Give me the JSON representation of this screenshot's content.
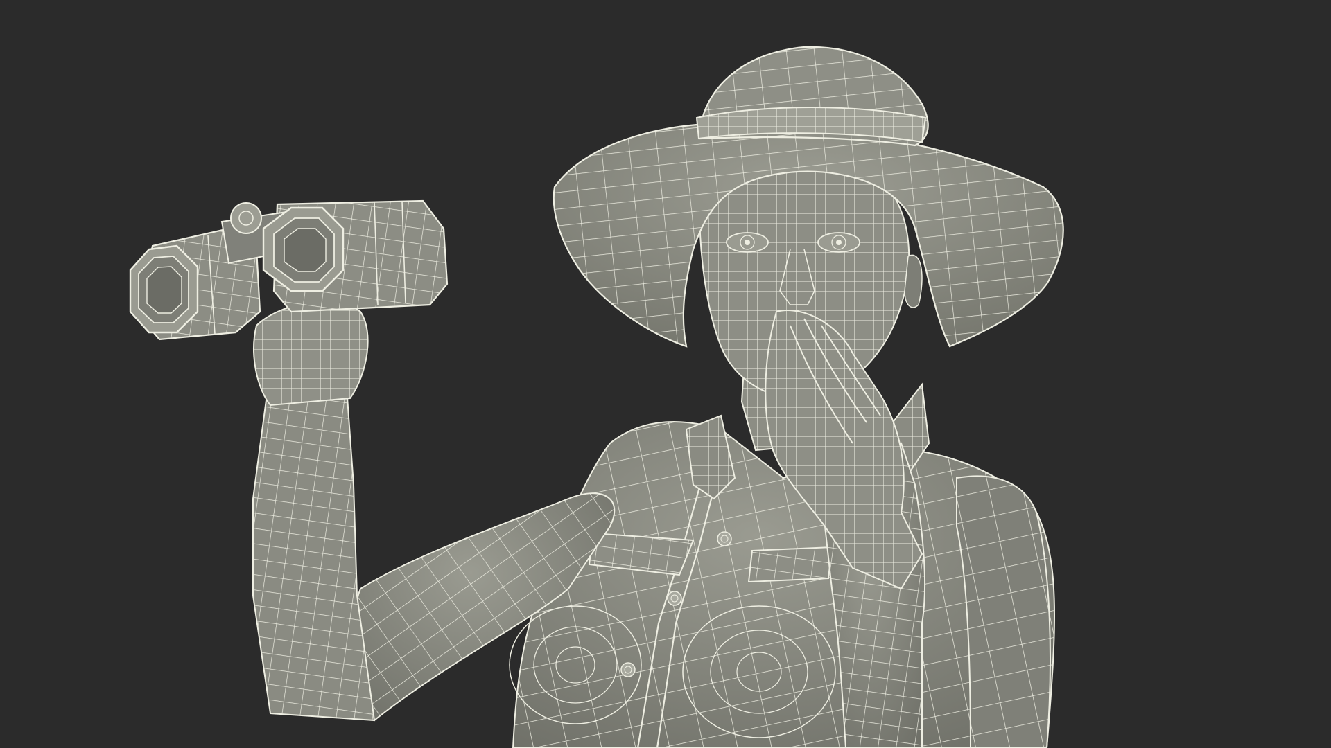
{
  "scene": {
    "subject": "wireframe-render-safari-woman-with-binoculars",
    "colors": {
      "background": "#2b2b2b",
      "mesh_fill": "#84857c",
      "mesh_fill_light": "#9a9b91",
      "mesh_fill_dark": "#65665e",
      "wire": "#eeeee2"
    }
  }
}
